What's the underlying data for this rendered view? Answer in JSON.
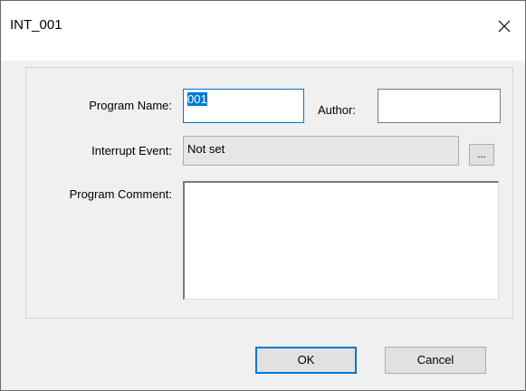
{
  "window": {
    "title": "INT_001",
    "close_glyph": "✕"
  },
  "form": {
    "program_name_label": "Program Name:",
    "program_name_value": "001",
    "author_label": "Author:",
    "author_value": "",
    "interrupt_event_label": "Interrupt Event:",
    "interrupt_event_value": "Not set",
    "browse_label": "...",
    "program_comment_label": "Program Comment:",
    "program_comment_value": ""
  },
  "buttons": {
    "ok_label": "OK",
    "cancel_label": "Cancel"
  },
  "colors": {
    "accent": "#0078d7",
    "window_bg": "#f0f0f0",
    "titlebar_bg": "#ffffff"
  },
  "icons": {
    "close": "close-icon"
  }
}
